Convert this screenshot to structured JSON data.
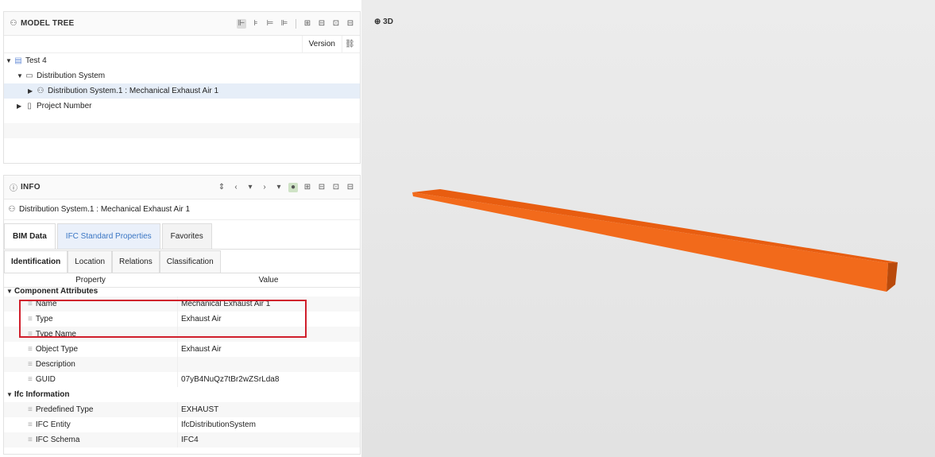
{
  "model_tree": {
    "title": "MODEL TREE",
    "version_label": "Version",
    "items": [
      {
        "label": "Test 4"
      },
      {
        "label": "Distribution System"
      },
      {
        "label": "Distribution System.1 : Mechanical Exhaust Air 1"
      },
      {
        "label": "Project Number"
      }
    ]
  },
  "info": {
    "title": "INFO",
    "object_name": "Distribution System.1 : Mechanical Exhaust Air 1",
    "tabs": [
      "BIM Data",
      "IFC Standard Properties",
      "Favorites"
    ],
    "subtabs": [
      "Identification",
      "Location",
      "Relations",
      "Classification"
    ],
    "columns": [
      "Property",
      "Value"
    ],
    "groups": [
      {
        "label": "Component Attributes"
      },
      {
        "label": "Ifc Information"
      }
    ],
    "rows1": [
      {
        "name": "Name",
        "value": "Mechanical Exhaust Air 1"
      },
      {
        "name": "Type",
        "value": "Exhaust Air"
      },
      {
        "name": "Type Name",
        "value": ""
      },
      {
        "name": "Object Type",
        "value": "Exhaust Air"
      },
      {
        "name": "Description",
        "value": ""
      },
      {
        "name": "GUID",
        "value": "07yB4NuQz7tBr2wZSrLda8"
      }
    ],
    "rows2": [
      {
        "name": "Predefined Type",
        "value": "EXHAUST"
      },
      {
        "name": "IFC Entity",
        "value": "IfcDistributionSystem"
      },
      {
        "name": "IFC Schema",
        "value": "IFC4"
      }
    ]
  },
  "viewport": {
    "label": "3D",
    "object_color": "#f26a1b"
  },
  "colors": {
    "selection": "#e6eef8",
    "highlight": "#d01f2c",
    "accent": "#3a76c4"
  }
}
